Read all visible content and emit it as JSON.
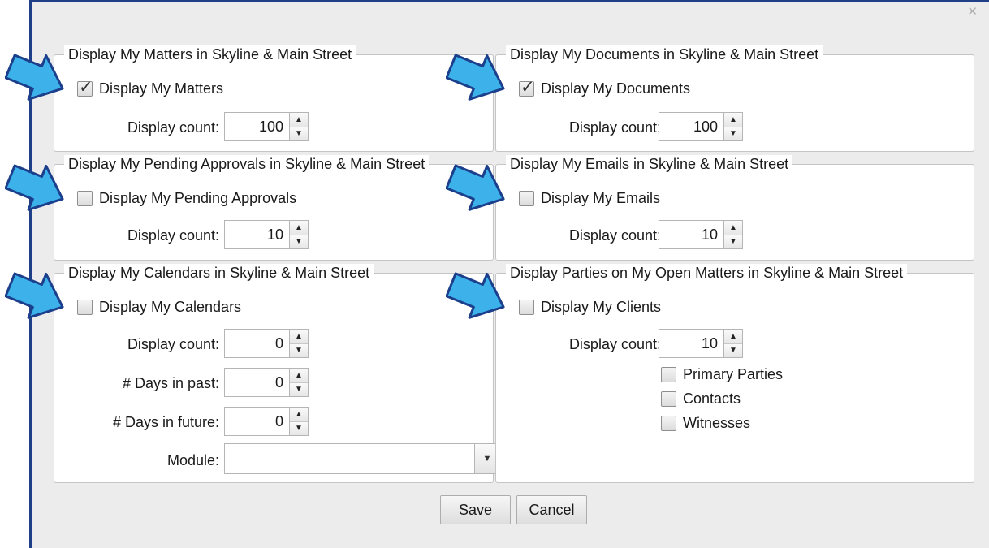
{
  "dialog": {
    "close_glyph": "✕"
  },
  "groups": {
    "matters": {
      "legend": "Display My Matters in Skyline & Main Street",
      "checkbox_label": "Display My Matters",
      "checked": true,
      "count_label": "Display count:",
      "count_value": "100"
    },
    "documents": {
      "legend": "Display My Documents in Skyline & Main Street",
      "checkbox_label": "Display My Documents",
      "checked": true,
      "count_label": "Display count:",
      "count_value": "100"
    },
    "approvals": {
      "legend": "Display My Pending Approvals in Skyline & Main Street",
      "checkbox_label": "Display My Pending Approvals",
      "checked": false,
      "count_label": "Display count:",
      "count_value": "10"
    },
    "emails": {
      "legend": "Display My Emails in Skyline & Main Street",
      "checkbox_label": "Display My Emails",
      "checked": false,
      "count_label": "Display count:",
      "count_value": "10"
    },
    "calendars": {
      "legend": "Display My Calendars in Skyline & Main Street",
      "checkbox_label": "Display My Calendars",
      "checked": false,
      "count_label": "Display count:",
      "count_value": "0",
      "past_label": "# Days in past:",
      "past_value": "0",
      "future_label": "# Days in future:",
      "future_value": "0",
      "module_label": "Module:",
      "module_value": ""
    },
    "parties": {
      "legend": "Display Parties on My Open Matters in Skyline & Main Street",
      "checkbox_label": "Display My Clients",
      "checked": false,
      "count_label": "Display count:",
      "count_value": "10",
      "sub_options": [
        {
          "label": "Primary Parties",
          "checked": false
        },
        {
          "label": "Contacts",
          "checked": false
        },
        {
          "label": "Witnesses",
          "checked": false
        }
      ]
    }
  },
  "buttons": {
    "save": "Save",
    "cancel": "Cancel"
  },
  "glyphs": {
    "check": "✓",
    "up": "▲",
    "down": "▼",
    "dropdown": "▼"
  },
  "colors": {
    "window_border": "#1f3f86",
    "arrow_fill": "#3cb1ea",
    "arrow_stroke": "#1c3f8c"
  },
  "icons": {
    "annotation": "blue-arrow-icon"
  }
}
